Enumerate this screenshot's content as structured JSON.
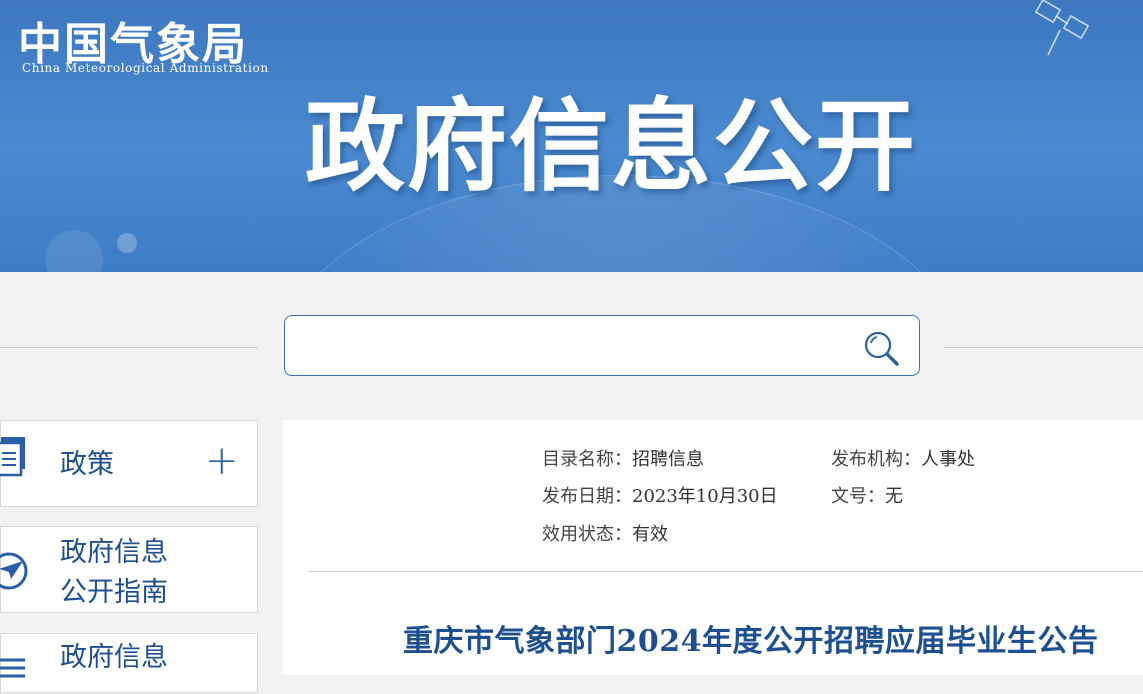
{
  "header": {
    "logo_cn": "中国气象局",
    "logo_en": "China Meteorological Administration",
    "title": "政府信息公开"
  },
  "search": {
    "value": "",
    "placeholder": ""
  },
  "sidebar": {
    "items": [
      {
        "label_line1": "政策",
        "label_line2": "",
        "icon": "document-icon",
        "expand": "+"
      },
      {
        "label_line1": "政府信息",
        "label_line2": "公开指南",
        "icon": "compass-icon"
      },
      {
        "label_line1": "政府信息",
        "label_line2": "",
        "icon": "list-icon"
      }
    ]
  },
  "meta": {
    "catalog_key": "目录名称：",
    "catalog_val": "招聘信息",
    "publisher_key": "发布机构：",
    "publisher_val": "人事处",
    "date_key": "发布日期：",
    "date_val": "2023年10月30日",
    "docno_key": "文号：",
    "docno_val": "无",
    "status_key": "效用状态：",
    "status_val": "有效"
  },
  "article": {
    "title": "重庆市气象部门2024年度公开招聘应届毕业生公告"
  },
  "colors": {
    "banner": "#4b8ad0",
    "accent": "#1d4f91",
    "border": "#3a6fb5"
  }
}
